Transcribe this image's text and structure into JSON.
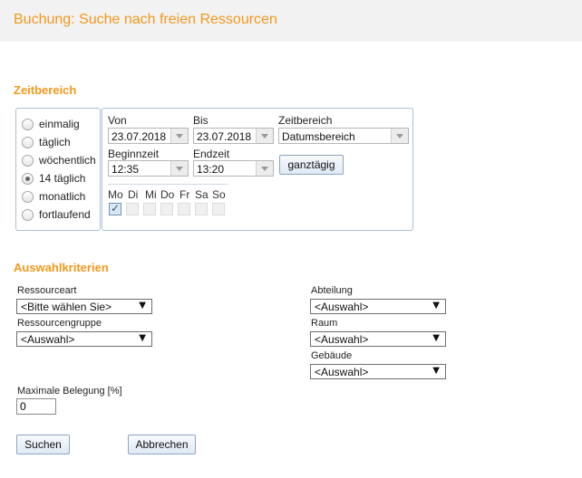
{
  "header": {
    "title": "Buchung: Suche nach freien Ressourcen"
  },
  "zeitbereich": {
    "title": "Zeitbereich",
    "recurrence": [
      "einmalig",
      "täglich",
      "wöchentlich",
      "14 täglich",
      "monatlich",
      "fortlaufend"
    ],
    "recurrence_selected": "14 täglich",
    "von_label": "Von",
    "von_value": "23.07.2018",
    "bis_label": "Bis",
    "bis_value": "23.07.2018",
    "zeitbereich_label": "Zeitbereich",
    "zeitbereich_value": "Datumsbereich",
    "beginnzeit_label": "Beginnzeit",
    "beginnzeit_value": "12:35",
    "endzeit_label": "Endzeit",
    "endzeit_value": "13:20",
    "ganztaegig_label": "ganztägig",
    "days": [
      "Mo",
      "Di",
      "Mi",
      "Do",
      "Fr",
      "Sa",
      "So"
    ],
    "days_checked": [
      "Mo"
    ]
  },
  "auswahl": {
    "title": "Auswahlkriterien",
    "ressourceart_label": "Ressourceart",
    "ressourceart_value": "<Bitte wählen Sie>",
    "ressourcengruppe_label": "Ressourcengruppe",
    "ressourcengruppe_value": "<Auswahl>",
    "abteilung_label": "Abteilung",
    "abteilung_value": "<Auswahl>",
    "raum_label": "Raum",
    "raum_value": "<Auswahl>",
    "gebaeude_label": "Gebäude",
    "gebaeude_value": "<Auswahl>",
    "max_belegung_label": "Maximale Belegung [%]",
    "max_belegung_value": "0"
  },
  "buttons": {
    "suchen": "Suchen",
    "abbrechen": "Abbrechen"
  },
  "icons": {
    "dropdown": "chevron-down-icon",
    "checkmark": "check-icon"
  },
  "colors": {
    "accent": "#f2981b",
    "header_bg": "#f2f2f2",
    "box_border": "#a9bfd6"
  }
}
